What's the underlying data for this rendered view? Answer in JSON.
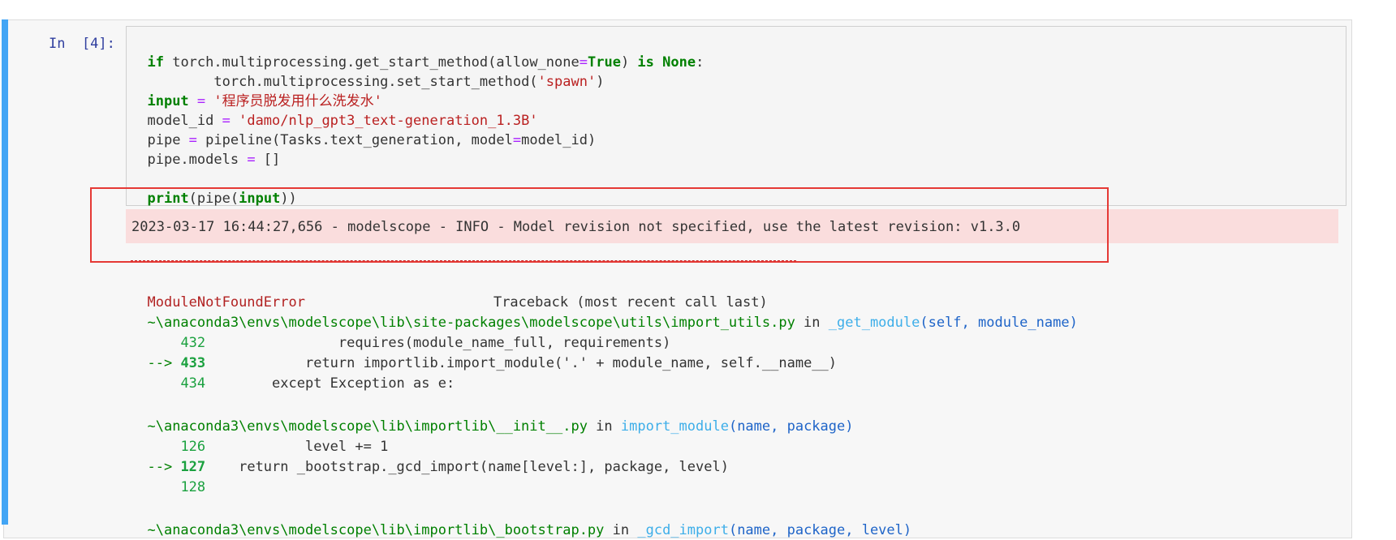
{
  "prompt": "In  [4]:",
  "code": {
    "line1": {
      "if": "if",
      "call": " torch.multiprocessing.get_start_method(",
      "kw_arg": "allow_none",
      "eq": "=",
      "true": "True",
      ")": ") ",
      "is": "is",
      "none": " None",
      ":": ":"
    },
    "line2": {
      "indent": "        ",
      "call": "torch.multiprocessing.set_start_method(",
      "str": "'spawn'",
      ")": ")"
    },
    "line3": {
      "name": "input",
      "eq": " = ",
      "str": "'程序员脱发用什么洗发水'"
    },
    "line4": {
      "name": "model_id",
      "eq": " = ",
      "str": "'damo/nlp_gpt3_text-generation_1.3B'"
    },
    "line5": {
      "text1": "pipe ",
      "eq": "=",
      "text2": " pipeline(Tasks.text_generation, model",
      "eq2": "=",
      "text3": "model_id)"
    },
    "line6": {
      "text1": "pipe.models ",
      "eq": "=",
      "text2": " []"
    },
    "line8": {
      "text1": "print",
      "p1": "(",
      "t2": "pipe",
      "p2": "(",
      "t3": "input",
      "p3": "))"
    }
  },
  "stderr": "2023-03-17 16:44:27,656 - modelscope - INFO - Model revision not specified, use the latest revision: v1.3.0",
  "traceback": {
    "error_name": "ModuleNotFoundError",
    "header": "Traceback (most recent call last)",
    "frames": [
      {
        "path": "~\\anaconda3\\envs\\modelscope\\lib\\site-packages\\modelscope\\utils\\import_utils.py",
        "in": " in ",
        "func": "_get_module",
        "args": "(self, module_name)",
        "lines": [
          {
            "prefix": "    ",
            "no": "432",
            "code": "                requires(module_name_full, requirements)"
          },
          {
            "prefix": "--> ",
            "no": "433",
            "code": "            return importlib.import_module('.' + module_name, self.__name__)"
          },
          {
            "prefix": "    ",
            "no": "434",
            "code": "        except Exception as e:"
          }
        ]
      },
      {
        "path": "~\\anaconda3\\envs\\modelscope\\lib\\importlib\\__init__.py",
        "in": " in ",
        "func": "import_module",
        "args": "(name, package)",
        "lines": [
          {
            "prefix": "    ",
            "no": "126",
            "code": "            level += 1"
          },
          {
            "prefix": "--> ",
            "no": "127",
            "code": "    return _bootstrap._gcd_import(name[level:], package, level)"
          },
          {
            "prefix": "    ",
            "no": "128",
            "code": ""
          }
        ]
      },
      {
        "path": "~\\anaconda3\\envs\\modelscope\\lib\\importlib\\_bootstrap.py",
        "in": " in ",
        "func": "_gcd_import",
        "args": "(name, package, level)"
      }
    ]
  }
}
